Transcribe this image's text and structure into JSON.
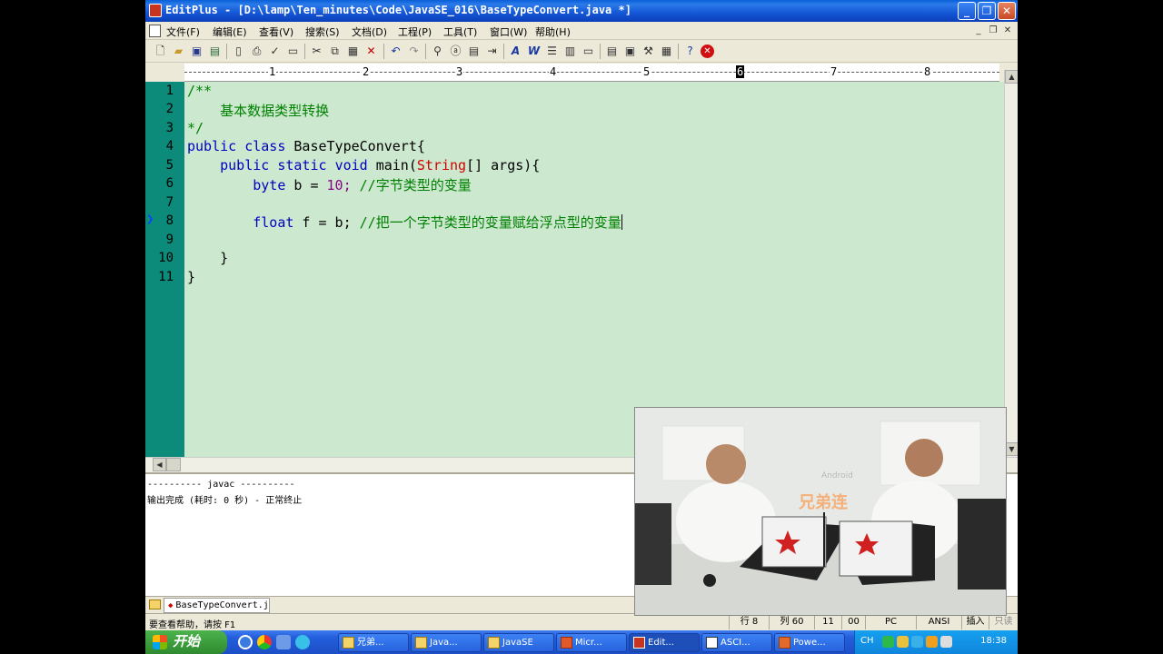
{
  "window": {
    "title": "EditPlus - [D:\\lamp\\Ten_minutes\\Code\\JavaSE_016\\BaseTypeConvert.java *]",
    "controls": {
      "minimize": "_",
      "restore": "❐",
      "close": "✕"
    }
  },
  "menu": {
    "items": [
      "文件(F)",
      "编辑(E)",
      "查看(V)",
      "搜索(S)",
      "文档(D)",
      "工程(P)",
      "工具(T)",
      "窗口(W)",
      "帮助(H)"
    ],
    "mdi_controls": {
      "minimize": "_",
      "restore": "❐",
      "close": "✕"
    }
  },
  "toolbar": {
    "icons": [
      "new-file-icon",
      "open-file-icon",
      "save-icon",
      "save-all-icon",
      "print-preview-icon",
      "print-icon",
      "spell-check-icon",
      "browser-icon",
      "cut-icon",
      "copy-icon",
      "paste-icon",
      "delete-icon",
      "undo-icon",
      "redo-icon",
      "find-icon",
      "replace-icon",
      "goto-icon",
      "indent-icon",
      "font-icon",
      "word-wrap-icon",
      "line-number-icon",
      "column-icon",
      "ruler-icon",
      "tile-icon",
      "cascade-icon",
      "tools-icon",
      "help-icon",
      "close-doc-icon"
    ]
  },
  "ruler": {
    "numbers": [
      "1",
      "2",
      "3",
      "4",
      "5",
      "6",
      "7",
      "8"
    ],
    "current": "6"
  },
  "editor": {
    "line_numbers": [
      "1",
      "2",
      "3",
      "4",
      "5",
      "6",
      "7",
      "8",
      "9",
      "10",
      "11"
    ],
    "lines": [
      {
        "indent": "",
        "text": "/**"
      },
      {
        "indent": "    ",
        "text": "基本数据类型转换"
      },
      {
        "indent": "",
        "text": "*/"
      },
      {
        "kw1": "public",
        "kw2": "class",
        "rest": "BaseTypeConvert{"
      },
      {
        "kw1": "public",
        "kw2": "static",
        "kw3": "void",
        "name": "main(",
        "type": "String",
        "rest": "[] args){"
      },
      {
        "kw": "byte",
        "mid": " b = ",
        "num": "10",
        "semi": ";",
        "comment": " //字节类型的变量"
      },
      {
        "text": ""
      },
      {
        "kw": "float",
        "mid": " f = b;",
        "comment": " //把一个字节类型的变量赋给浮点型的变量"
      },
      {
        "text": ""
      },
      {
        "text": "}"
      },
      {
        "text": "}"
      }
    ]
  },
  "output": {
    "lines": [
      "---------- javac ----------",
      "输出完成 (耗时: 0 秒) - 正常终止"
    ]
  },
  "doc_tab": {
    "label": "BaseTypeConvert.java"
  },
  "status": {
    "help": "要查看帮助，请按 F1",
    "row": "行 8",
    "col": "列 60",
    "sel": "11",
    "sel2": "00",
    "mode": "PC",
    "encoding": "ANSI",
    "insert": "插入",
    "readonly": "只读"
  },
  "taskbar": {
    "start": "开始",
    "tasks": [
      "兄弟...",
      "Java...",
      "JavaSE",
      "Micr...",
      "Edit...",
      "ASCI...",
      "Powe..."
    ],
    "active_task": 4,
    "ime": "CH",
    "clock": "18:38"
  },
  "video": {
    "brand_text": "兄弟连",
    "tag": "Android"
  },
  "colors": {
    "editor_bg": "#cce8cf",
    "gutter_bg": "#0c8a7a",
    "keyword": "#0000c0",
    "comment": "#008000",
    "string_type": "#d00000"
  }
}
